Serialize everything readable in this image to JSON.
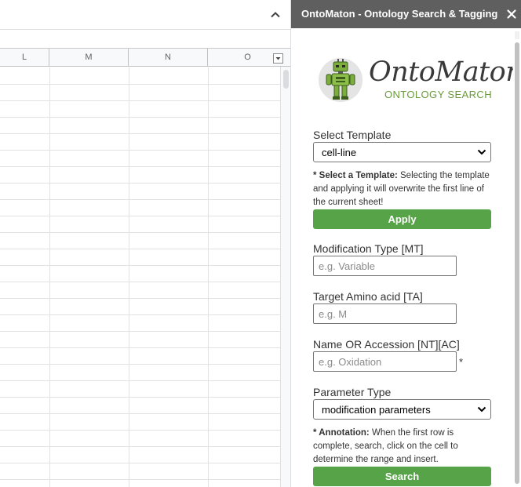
{
  "colors": {
    "panel_header": "#5f5f5f",
    "button_green": "#57a347",
    "logo_green": "#6a9a3a"
  },
  "sheet": {
    "columns": [
      "L",
      "M",
      "N",
      "O"
    ],
    "collapse_icon": "chevron-up-icon",
    "filter_icon": "dropdown-arrow-icon"
  },
  "panel": {
    "title": "OntoMaton - Ontology Search & Tagging",
    "close_icon": "close-icon",
    "logo": {
      "title": "OntoMaton",
      "subtitle": "ONTOLOGY SEARCH"
    },
    "template": {
      "label": "Select Template",
      "selected": "cell-line",
      "note_bold": "* Select a Template:",
      "note_text": " Selecting the template and applying it will overwrite the first line of the current sheet!",
      "apply_label": "Apply"
    },
    "modification_type": {
      "label": "Modification Type [MT]",
      "placeholder": "e.g. Variable",
      "value": ""
    },
    "target_amino_acid": {
      "label": "Target Amino acid [TA]",
      "placeholder": "e.g. M",
      "value": ""
    },
    "name_accession": {
      "label": "Name OR Accession [NT][AC]",
      "placeholder": "e.g. Oxidation",
      "value": "",
      "required_mark": "*"
    },
    "parameter_type": {
      "label": "Parameter Type",
      "selected": "modification parameters"
    },
    "annotation": {
      "note_bold": "* Annotation:",
      "note_text": " When the first row is complete, search, click on the cell to determine the range and insert.",
      "search_label": "Search"
    }
  }
}
